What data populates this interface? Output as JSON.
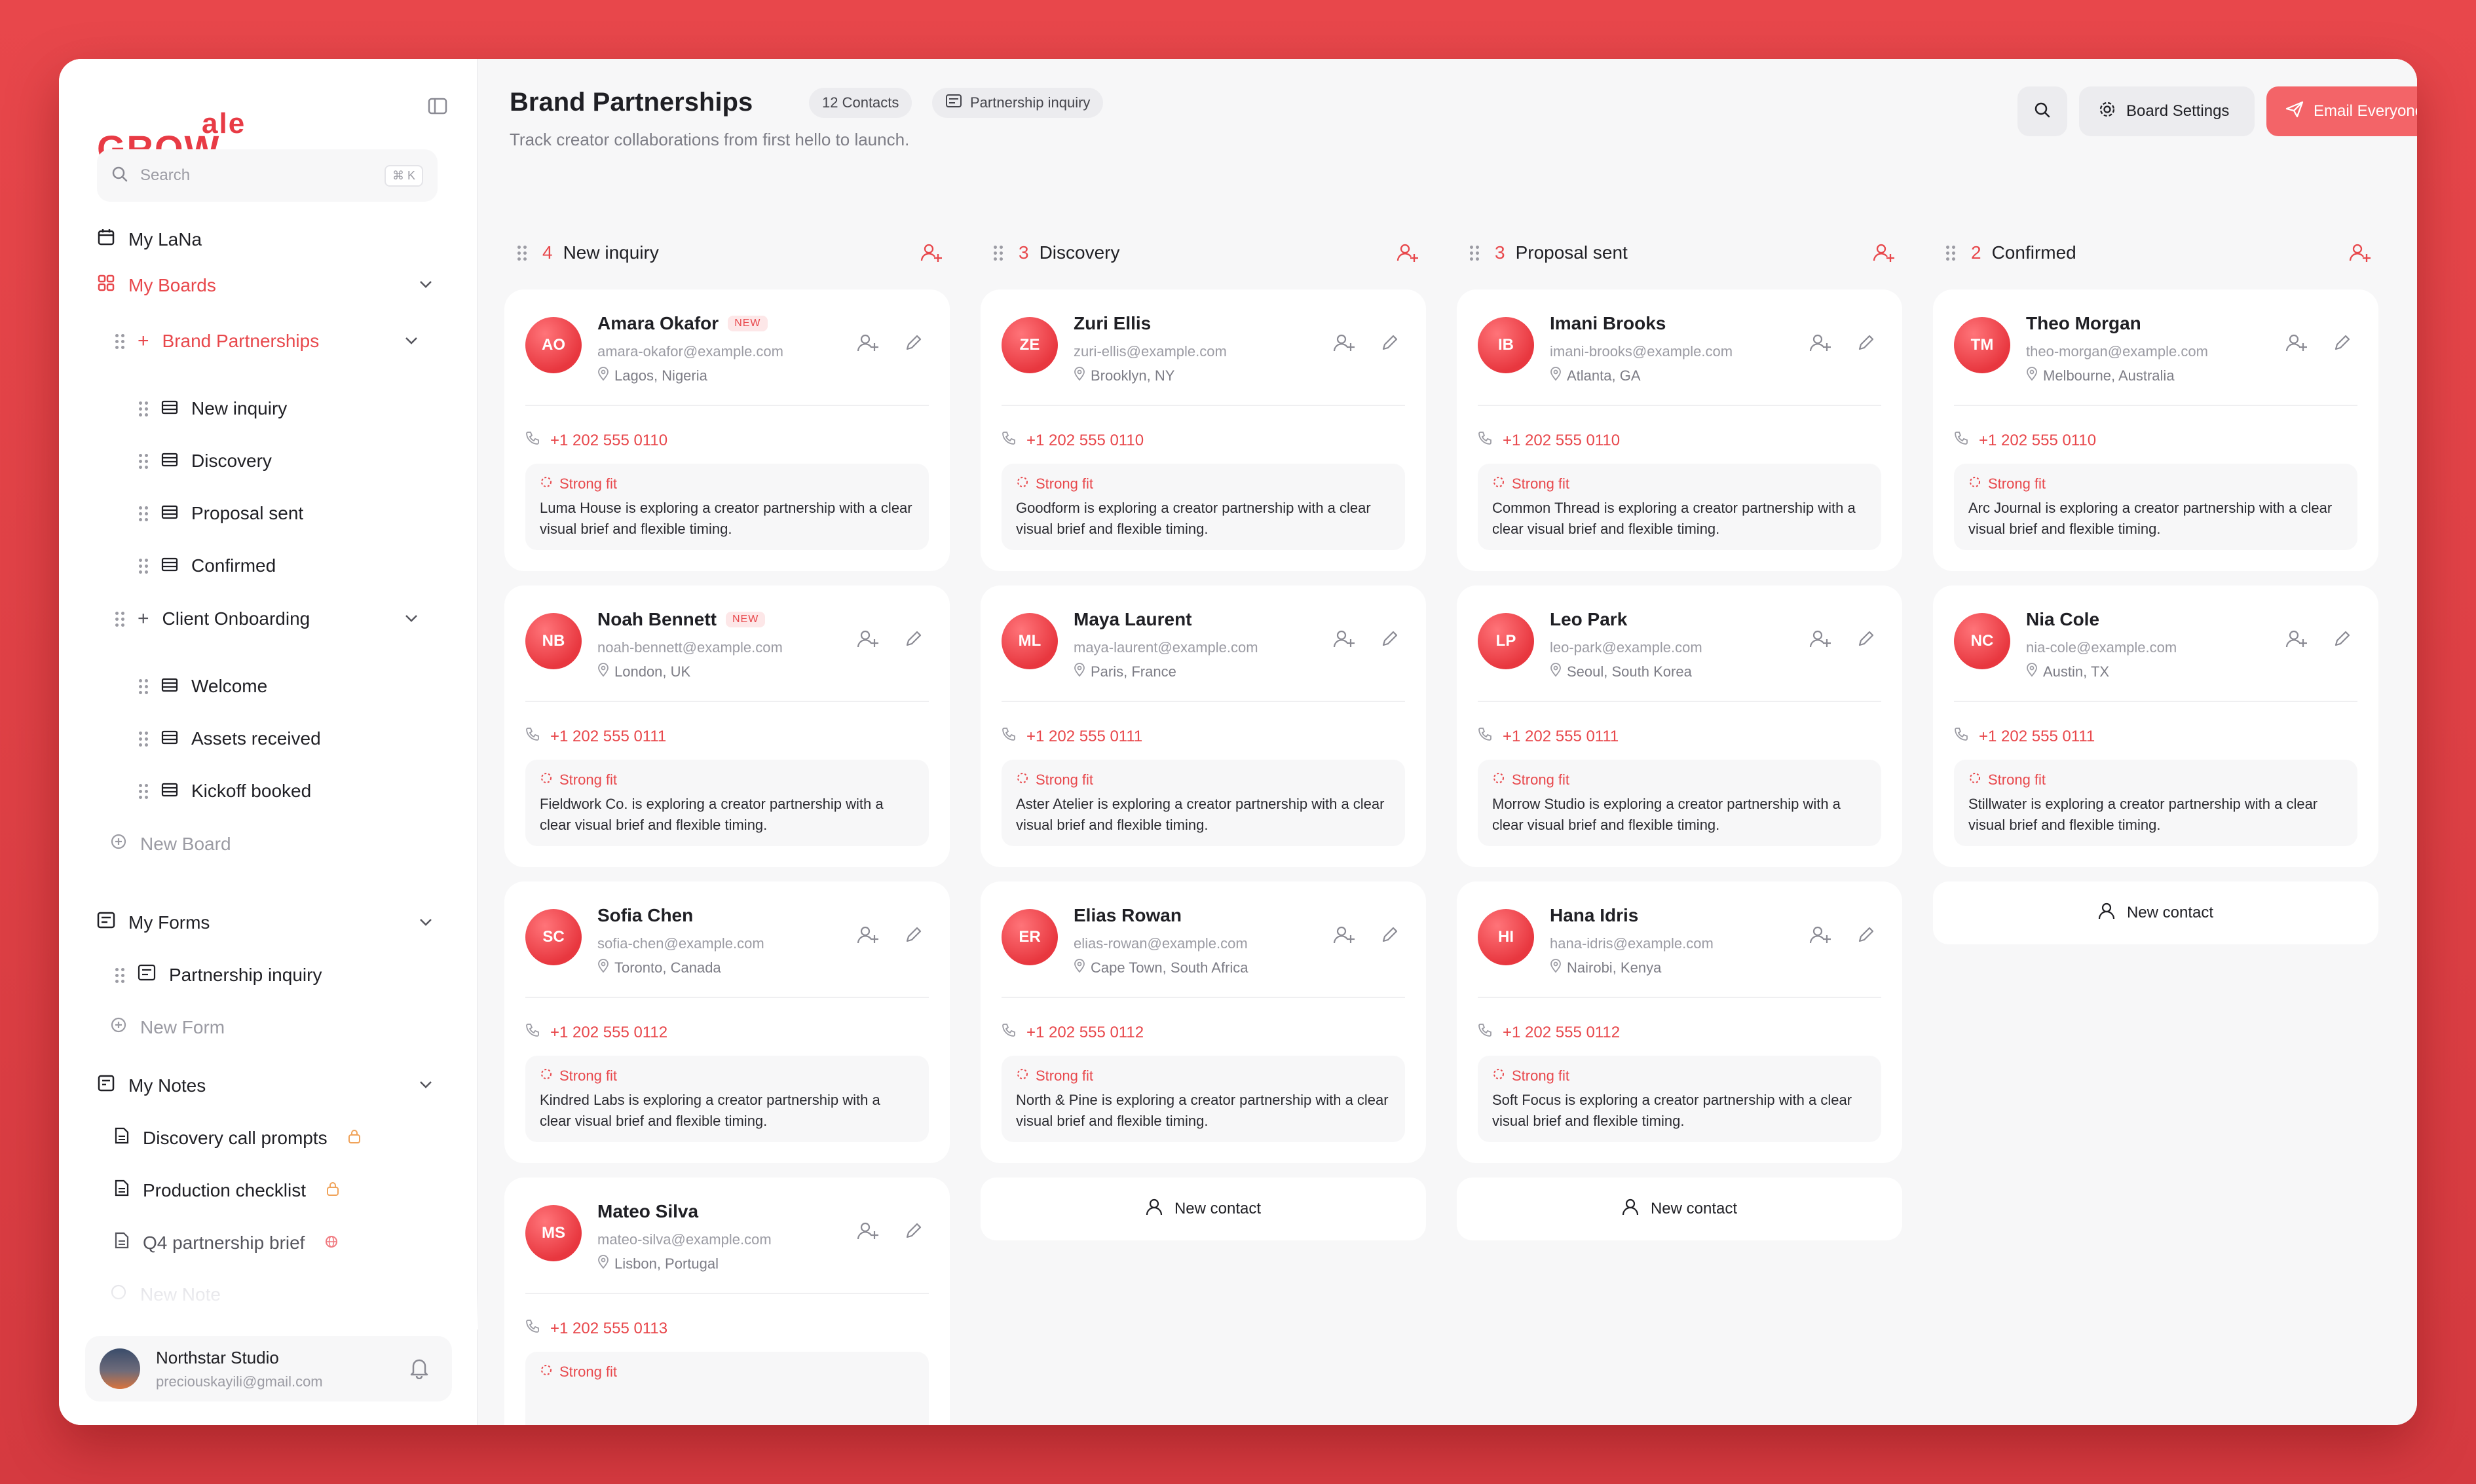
{
  "brand": {
    "logo_main": "GROW",
    "logo_sup": "ale"
  },
  "sidebar": {
    "search_placeholder": "Search",
    "search_shortcut": "⌘ K",
    "my_lana": "My LaNa",
    "my_boards": "My Boards",
    "boards": [
      {
        "label": "Brand Partnerships",
        "stages": [
          "New inquiry",
          "Discovery",
          "Proposal sent",
          "Confirmed"
        ]
      },
      {
        "label": "Client Onboarding",
        "stages": [
          "Welcome",
          "Assets received",
          "Kickoff booked"
        ]
      }
    ],
    "new_board": "New Board",
    "my_forms": "My Forms",
    "forms": [
      "Partnership inquiry"
    ],
    "new_form": "New Form",
    "my_notes": "My Notes",
    "notes": [
      "Discovery call prompts",
      "Production checklist",
      "Q4 partnership brief"
    ],
    "new_note": "New Note",
    "user": {
      "name": "Northstar Studio",
      "email": "preciouskayili@gmail.com"
    }
  },
  "header": {
    "title": "Brand Partnerships",
    "contacts_pill": "12 Contacts",
    "form_pill": "Partnership inquiry",
    "subtitle": "Track creator collaborations from first hello to launch.",
    "board_settings": "Board Settings",
    "email_everyone": "Email Everyone"
  },
  "colors": {
    "accent": "#e8474b",
    "primary_button": "#f36468",
    "background": "#f7f7f8"
  },
  "new_contact_label": "New contact",
  "fit_label": "Strong fit",
  "columns": [
    {
      "count": "4",
      "title": "New inquiry",
      "cards": [
        {
          "initials": "AO",
          "name": "Amara Okafor",
          "badge": "NEW",
          "email": "amara-okafor@example.com",
          "location": "Lagos, Nigeria",
          "phone": "+1 202 555 0110",
          "desc": "Luma House is exploring a creator partnership with a clear visual brief and flexible timing."
        },
        {
          "initials": "NB",
          "name": "Noah Bennett",
          "badge": "NEW",
          "email": "noah-bennett@example.com",
          "location": "London, UK",
          "phone": "+1 202 555 0111",
          "desc": "Fieldwork Co. is exploring a creator partnership with a clear visual brief and flexible timing."
        },
        {
          "initials": "SC",
          "name": "Sofia Chen",
          "badge": "",
          "email": "sofia-chen@example.com",
          "location": "Toronto, Canada",
          "phone": "+1 202 555 0112",
          "desc": "Kindred Labs is exploring a creator partnership with a clear visual brief and flexible timing."
        },
        {
          "initials": "MS",
          "name": "Mateo Silva",
          "badge": "",
          "email": "mateo-silva@example.com",
          "location": "Lisbon, Portugal",
          "phone": "+1 202 555 0113",
          "desc": ""
        }
      ],
      "show_new_contact": false
    },
    {
      "count": "3",
      "title": "Discovery",
      "cards": [
        {
          "initials": "ZE",
          "name": "Zuri Ellis",
          "badge": "",
          "email": "zuri-ellis@example.com",
          "location": "Brooklyn, NY",
          "phone": "+1 202 555 0110",
          "desc": "Goodform is exploring a creator partnership with a clear visual brief and flexible timing."
        },
        {
          "initials": "ML",
          "name": "Maya Laurent",
          "badge": "",
          "email": "maya-laurent@example.com",
          "location": "Paris, France",
          "phone": "+1 202 555 0111",
          "desc": "Aster Atelier is exploring a creator partnership with a clear visual brief and flexible timing."
        },
        {
          "initials": "ER",
          "name": "Elias Rowan",
          "badge": "",
          "email": "elias-rowan@example.com",
          "location": "Cape Town, South Africa",
          "phone": "+1 202 555 0112",
          "desc": "North & Pine is exploring a creator partnership with a clear visual brief and flexible timing."
        }
      ],
      "show_new_contact": true
    },
    {
      "count": "3",
      "title": "Proposal sent",
      "cards": [
        {
          "initials": "IB",
          "name": "Imani Brooks",
          "badge": "",
          "email": "imani-brooks@example.com",
          "location": "Atlanta, GA",
          "phone": "+1 202 555 0110",
          "desc": "Common Thread is exploring a creator partnership with a clear visual brief and flexible timing."
        },
        {
          "initials": "LP",
          "name": "Leo Park",
          "badge": "",
          "email": "leo-park@example.com",
          "location": "Seoul, South Korea",
          "phone": "+1 202 555 0111",
          "desc": "Morrow Studio is exploring a creator partnership with a clear visual brief and flexible timing."
        },
        {
          "initials": "HI",
          "name": "Hana Idris",
          "badge": "",
          "email": "hana-idris@example.com",
          "location": "Nairobi, Kenya",
          "phone": "+1 202 555 0112",
          "desc": "Soft Focus is exploring a creator partnership with a clear visual brief and flexible timing."
        }
      ],
      "show_new_contact": true
    },
    {
      "count": "2",
      "title": "Confirmed",
      "cards": [
        {
          "initials": "TM",
          "name": "Theo Morgan",
          "badge": "",
          "email": "theo-morgan@example.com",
          "location": "Melbourne, Australia",
          "phone": "+1 202 555 0110",
          "desc": "Arc Journal is exploring a creator partnership with a clear visual brief and flexible timing."
        },
        {
          "initials": "NC",
          "name": "Nia Cole",
          "badge": "",
          "email": "nia-cole@example.com",
          "location": "Austin, TX",
          "phone": "+1 202 555 0111",
          "desc": "Stillwater is exploring a creator partnership with a clear visual brief and flexible timing."
        }
      ],
      "show_new_contact": true
    }
  ]
}
